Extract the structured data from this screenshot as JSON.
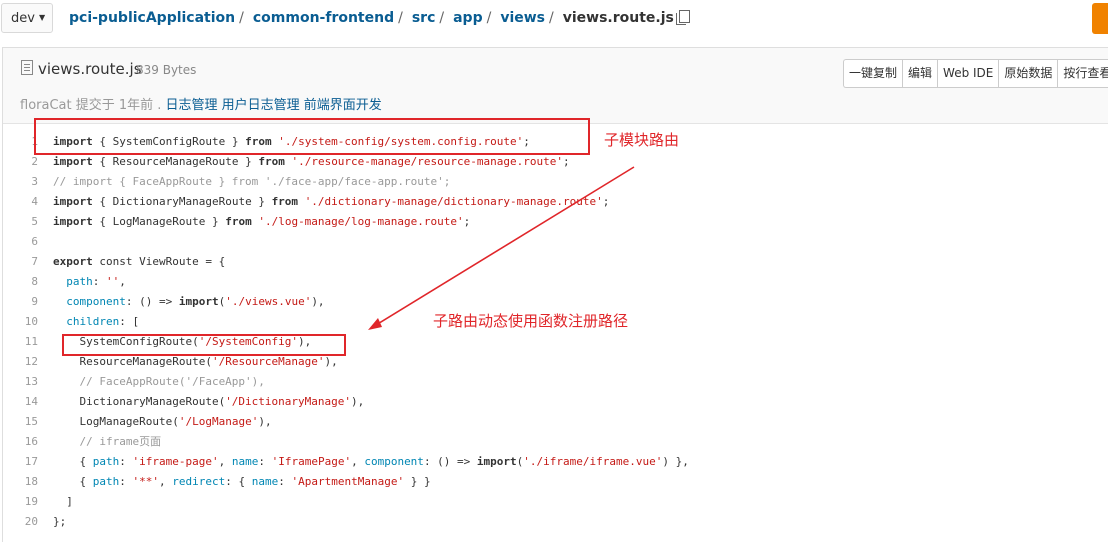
{
  "topbar": {
    "branch": "dev",
    "crumbs": [
      "pci-publicApplication",
      "common-frontend",
      "src",
      "app",
      "views"
    ],
    "filename": "views.route.js"
  },
  "file": {
    "name": "views.route.js",
    "size": "839 Bytes",
    "author": "floraCat",
    "committed": "提交于 1年前 .",
    "message": "日志管理 用户日志管理 前端界面开发",
    "buttons": [
      "一键复制",
      "编辑",
      "Web IDE",
      "原始数据",
      "按行查看"
    ]
  },
  "code": [
    {
      "n": "1",
      "segs": [
        [
          "kw",
          "import"
        ],
        [
          "p",
          " { SystemConfigRoute } "
        ],
        [
          "kw",
          "from"
        ],
        [
          "p",
          " "
        ],
        [
          "str",
          "'./system-config/system.config.route'"
        ],
        [
          "p",
          ";"
        ]
      ]
    },
    {
      "n": "2",
      "segs": [
        [
          "kw",
          "import"
        ],
        [
          "p",
          " { ResourceManageRoute } "
        ],
        [
          "kw",
          "from"
        ],
        [
          "p",
          " "
        ],
        [
          "str",
          "'./resource-manage/resource-manage.route'"
        ],
        [
          "p",
          ";"
        ]
      ]
    },
    {
      "n": "3",
      "segs": [
        [
          "cm",
          "// import { FaceAppRoute } from './face-app/face-app.route';"
        ]
      ]
    },
    {
      "n": "4",
      "segs": [
        [
          "kw",
          "import"
        ],
        [
          "p",
          " { DictionaryManageRoute } "
        ],
        [
          "kw",
          "from"
        ],
        [
          "p",
          " "
        ],
        [
          "str",
          "'./dictionary-manage/dictionary-manage.route'"
        ],
        [
          "p",
          ";"
        ]
      ]
    },
    {
      "n": "5",
      "segs": [
        [
          "kw",
          "import"
        ],
        [
          "p",
          " { LogManageRoute } "
        ],
        [
          "kw",
          "from"
        ],
        [
          "p",
          " "
        ],
        [
          "str",
          "'./log-manage/log-manage.route'"
        ],
        [
          "p",
          ";"
        ]
      ]
    },
    {
      "n": "6",
      "segs": []
    },
    {
      "n": "7",
      "segs": [
        [
          "kw",
          "export"
        ],
        [
          "p",
          " const ViewRoute = {"
        ]
      ]
    },
    {
      "n": "8",
      "segs": [
        [
          "p",
          "  "
        ],
        [
          "prop",
          "path"
        ],
        [
          "p",
          ": "
        ],
        [
          "str",
          "''"
        ],
        [
          "p",
          ","
        ]
      ]
    },
    {
      "n": "9",
      "segs": [
        [
          "p",
          "  "
        ],
        [
          "prop",
          "component"
        ],
        [
          "p",
          ": () => "
        ],
        [
          "kw",
          "import"
        ],
        [
          "p",
          "("
        ],
        [
          "str",
          "'./views.vue'"
        ],
        [
          "p",
          "),"
        ]
      ]
    },
    {
      "n": "10",
      "segs": [
        [
          "p",
          "  "
        ],
        [
          "prop",
          "children"
        ],
        [
          "p",
          ": ["
        ]
      ]
    },
    {
      "n": "11",
      "segs": [
        [
          "p",
          "    SystemConfigRoute("
        ],
        [
          "str",
          "'/SystemConfig'"
        ],
        [
          "p",
          "),"
        ]
      ]
    },
    {
      "n": "12",
      "segs": [
        [
          "p",
          "    ResourceManageRoute("
        ],
        [
          "str",
          "'/ResourceManage'"
        ],
        [
          "p",
          "),"
        ]
      ]
    },
    {
      "n": "13",
      "segs": [
        [
          "cm",
          "    // FaceAppRoute('/FaceApp'),"
        ]
      ]
    },
    {
      "n": "14",
      "segs": [
        [
          "p",
          "    DictionaryManageRoute("
        ],
        [
          "str",
          "'/DictionaryManage'"
        ],
        [
          "p",
          "),"
        ]
      ]
    },
    {
      "n": "15",
      "segs": [
        [
          "p",
          "    LogManageRoute("
        ],
        [
          "str",
          "'/LogManage'"
        ],
        [
          "p",
          "),"
        ]
      ]
    },
    {
      "n": "16",
      "segs": [
        [
          "cm",
          "    // iframe页面"
        ]
      ]
    },
    {
      "n": "17",
      "segs": [
        [
          "p",
          "    { "
        ],
        [
          "prop",
          "path"
        ],
        [
          "p",
          ": "
        ],
        [
          "str",
          "'iframe-page'"
        ],
        [
          "p",
          ", "
        ],
        [
          "prop",
          "name"
        ],
        [
          "p",
          ": "
        ],
        [
          "str",
          "'IframePage'"
        ],
        [
          "p",
          ", "
        ],
        [
          "prop",
          "component"
        ],
        [
          "p",
          ": () => "
        ],
        [
          "kw",
          "import"
        ],
        [
          "p",
          "("
        ],
        [
          "str",
          "'./iframe/iframe.vue'"
        ],
        [
          "p",
          ") },"
        ]
      ]
    },
    {
      "n": "18",
      "segs": [
        [
          "p",
          "    { "
        ],
        [
          "prop",
          "path"
        ],
        [
          "p",
          ": "
        ],
        [
          "str",
          "'**'"
        ],
        [
          "p",
          ", "
        ],
        [
          "prop",
          "redirect"
        ],
        [
          "p",
          ": { "
        ],
        [
          "prop",
          "name"
        ],
        [
          "p",
          ": "
        ],
        [
          "str",
          "'ApartmentManage'"
        ],
        [
          "p",
          " } }"
        ]
      ]
    },
    {
      "n": "19",
      "segs": [
        [
          "p",
          "  ]"
        ]
      ]
    },
    {
      "n": "20",
      "segs": [
        [
          "p",
          "};"
        ]
      ]
    }
  ],
  "annotations": {
    "note1": "子模块路由",
    "note2": "子路由动态使用函数注册路径"
  },
  "colors": {
    "annotation": "#e0262a",
    "link": "#0a5d92",
    "accent": "#f08200"
  }
}
